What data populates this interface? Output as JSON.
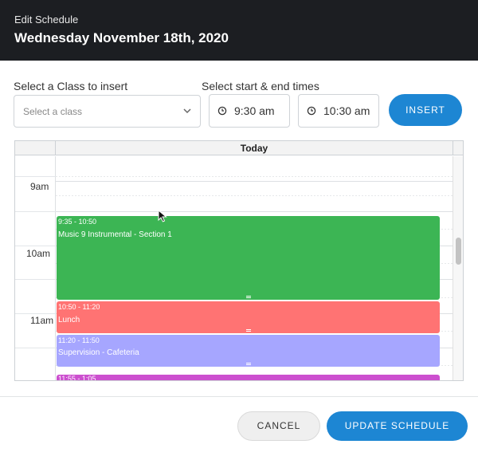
{
  "header": {
    "eyebrow": "Edit Schedule",
    "title": "Wednesday November 18th, 2020"
  },
  "form": {
    "class_label": "Select a Class to insert",
    "class_placeholder": "Select a class",
    "times_label": "Select start & end times",
    "start_time": "9:30 am",
    "end_time": "10:30 am",
    "insert_label": "INSERT"
  },
  "calendar": {
    "column_header": "Today",
    "hours": [
      "9am",
      "10am",
      "11am"
    ],
    "events": [
      {
        "time": "9:35 - 10:50",
        "name": "Music 9 Instrumental - Section 1",
        "color": "#3cb554"
      },
      {
        "time": "10:50 - 11:20",
        "name": "Lunch",
        "color": "#ff7373"
      },
      {
        "time": "11:20 - 11:50",
        "name": "Supervision - Cafeteria",
        "color": "#a6a6ff"
      },
      {
        "time": "11:55 - 1:05",
        "name": "",
        "color": "#cc4fcf"
      }
    ]
  },
  "footer": {
    "cancel_label": "CANCEL",
    "update_label": "UPDATE SCHEDULE"
  },
  "colors": {
    "header_bg": "#1c1e22",
    "primary": "#1d86d3"
  },
  "icons": {
    "select_chevron": "chevron-down-icon",
    "time": "clock-icon",
    "pointer": "mouse-cursor-icon"
  }
}
